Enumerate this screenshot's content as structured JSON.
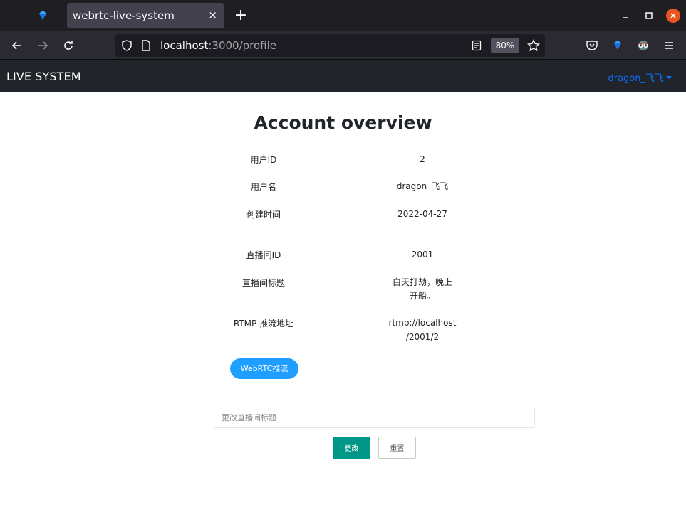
{
  "browser": {
    "tab_title": "webrtc-live-system",
    "tab_close": "×",
    "new_tab": "+",
    "url_host": "localhost",
    "url_rest": ":3000/profile",
    "zoom": "80%"
  },
  "app": {
    "brand": "LIVE SYSTEM",
    "user_name": "dragon_飞飞"
  },
  "profile": {
    "title": "Account overview",
    "fields": [
      {
        "label": "用户ID",
        "value": "2"
      },
      {
        "label": "用户名",
        "value": "dragon_飞飞"
      },
      {
        "label": "创建时间",
        "value": "2022-04-27"
      },
      {
        "label": "直播间ID",
        "value": "2001"
      },
      {
        "label": "直播间标题",
        "value_line1": "白天打劫，晚上",
        "value_line2": "开船。"
      },
      {
        "label": "RTMP 推流地址",
        "value_line1": "rtmp://localhost",
        "value_line2": "/2001/2"
      }
    ],
    "webrtc_button": "WebRTC推流"
  },
  "form": {
    "title_placeholder": "更改直播间标题",
    "submit_label": "更改",
    "reset_label": "重置"
  },
  "colors": {
    "accent_blue": "#1e9fff",
    "submit_teal": "#009688",
    "user_link": "#0d6efd",
    "header_bg": "#212529"
  }
}
